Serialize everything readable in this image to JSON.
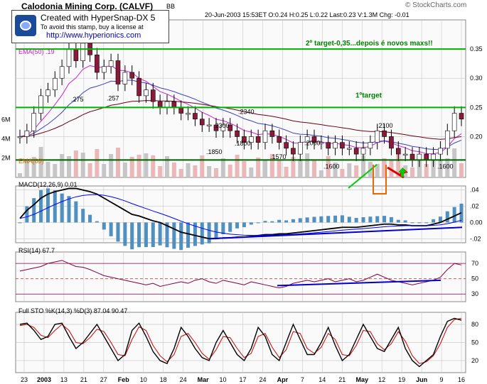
{
  "header": {
    "source": "© StockCharts.com",
    "title": "Calodonia Mining Corp. (CALVF)",
    "exchange": "BB",
    "quote": "20-Jun-2003 15:53ET  O:0.24 H:0.25 L:0.22 Last:0.23 V:1.3M Chg: -0.01"
  },
  "stamp": {
    "line1": "Created with HyperSnap-DX 5",
    "line2": "To avoid this stamp, buy a license at",
    "line3": "http://www.hyperionics.com"
  },
  "colors": {
    "bg": "#fafafa",
    "grid": "#c8c8c8",
    "price_up": "#ffffff",
    "price_down": "#8b1a3a",
    "ema_short": "#d020d0",
    "ema_long": "#6a0018",
    "volume": "#c0c0c0",
    "volume_down": "#e8b0b0",
    "target_line": "#00b000",
    "support_line": "#006000",
    "trend_line": "#0000cc",
    "arrow_red": "#dd0000",
    "arrow_green": "#00cc00",
    "arrow_orange": "#ee6600",
    "macd": "#000000",
    "signal": "#0000ff",
    "histogram": "#5090c0",
    "rsi": "#800040",
    "sto_k": "#000000",
    "sto_d": "#cc0000"
  },
  "chart_data": [
    {
      "type": "line",
      "panel": "price",
      "legend": [
        "EMA(50) .19",
        "EMA(60)"
      ],
      "yaxis_right": [
        0.35,
        0.3,
        0.25,
        0.2
      ],
      "yaxis_left_volume": [
        "6M",
        "4M",
        "2M"
      ],
      "ylim": [
        0.13,
        0.4
      ],
      "x_labels": [
        "23",
        "2003",
        "13",
        "21",
        "27",
        "Feb",
        "10",
        "18",
        "24",
        "Mar",
        "10",
        "17",
        "24",
        "Apr",
        "7",
        "14",
        "21",
        "May",
        "12",
        "19",
        "Jun",
        "9",
        "16"
      ],
      "close": [
        0.2,
        0.21,
        0.24,
        0.27,
        0.28,
        0.3,
        0.32,
        0.35,
        0.33,
        0.36,
        0.34,
        0.31,
        0.32,
        0.33,
        0.29,
        0.31,
        0.3,
        0.27,
        0.28,
        0.26,
        0.25,
        0.26,
        0.25,
        0.24,
        0.24,
        0.23,
        0.22,
        0.22,
        0.21,
        0.22,
        0.21,
        0.2,
        0.19,
        0.2,
        0.19,
        0.21,
        0.2,
        0.19,
        0.18,
        0.17,
        0.19,
        0.2,
        0.19,
        0.19,
        0.18,
        0.19,
        0.18,
        0.18,
        0.17,
        0.18,
        0.19,
        0.21,
        0.2,
        0.18,
        0.17,
        0.17,
        0.16,
        0.17,
        0.16,
        0.17,
        0.18,
        0.21,
        0.24,
        0.23
      ],
      "levels": [
        {
          "label": "2º target-0,35...depois é novos maxs!!",
          "value": 0.35
        },
        {
          "label": "1ºtarget",
          "value": 0.25
        },
        {
          "label": "",
          "value": 0.16
        }
      ],
      "annotations": [
        {
          "text": ".275",
          "value": 0.275
        },
        {
          "text": ".257",
          "value": 0.257
        },
        {
          "text": ".2300",
          "value": 0.23
        },
        {
          "text": ".2340",
          "value": 0.234
        },
        {
          "text": ".1850",
          "value": 0.185
        },
        {
          "text": ".1800",
          "value": 0.18
        },
        {
          "text": ".2000",
          "value": 0.2
        },
        {
          "text": ".1570",
          "value": 0.157
        },
        {
          "text": ".1600",
          "value": 0.16
        },
        {
          "text": ".2100",
          "value": 0.21
        },
        {
          "text": ".1600",
          "value": 0.16
        }
      ]
    },
    {
      "type": "line",
      "panel": "macd",
      "title": "MACD(12,26,9) 0.01",
      "yaxis_right": [
        ".04",
        ".02",
        "0.00",
        "-.02"
      ],
      "ylim": [
        -0.025,
        0.045
      ],
      "macd": [
        0.005,
        0.015,
        0.022,
        0.03,
        0.035,
        0.038,
        0.04,
        0.042,
        0.042,
        0.04,
        0.038,
        0.035,
        0.03,
        0.025,
        0.02,
        0.015,
        0.01,
        0.008,
        0.005,
        0.002,
        0.0,
        -0.004,
        -0.008,
        -0.012,
        -0.014,
        -0.016,
        -0.018,
        -0.02,
        -0.02,
        -0.019,
        -0.019,
        -0.018,
        -0.018,
        -0.017,
        -0.016,
        -0.015,
        -0.015,
        -0.014,
        -0.014,
        -0.013,
        -0.012,
        -0.011,
        -0.01,
        -0.009,
        -0.008,
        -0.007,
        -0.006,
        -0.006,
        -0.006,
        -0.005,
        -0.004,
        -0.003,
        -0.002,
        -0.002,
        -0.003,
        -0.003,
        -0.004,
        -0.004,
        -0.004,
        -0.002,
        0.0,
        0.004,
        0.008,
        0.012
      ]
    },
    {
      "type": "line",
      "panel": "rsi",
      "title": "RSI(14) 67.7",
      "yaxis_right": [
        "70",
        "50",
        "30"
      ],
      "ylim": [
        20,
        85
      ],
      "rsi": [
        60,
        62,
        64,
        66,
        70,
        72,
        74,
        70,
        66,
        65,
        62,
        58,
        54,
        52,
        50,
        48,
        46,
        44,
        42,
        44,
        40,
        42,
        44,
        46,
        44,
        48,
        50,
        46,
        44,
        48,
        46,
        44,
        42,
        46,
        44,
        42,
        40,
        38,
        40,
        44,
        46,
        48,
        46,
        48,
        50,
        46,
        48,
        50,
        46,
        48,
        52,
        56,
        52,
        48,
        46,
        44,
        42,
        44,
        46,
        48,
        52,
        62,
        70,
        68
      ]
    },
    {
      "type": "line",
      "panel": "stochastic",
      "title": "Full STO %K(14,3) %D(3) 87.04 90.47",
      "yaxis_right": [
        "80",
        "50",
        "20"
      ],
      "ylim": [
        0,
        100
      ],
      "k": [
        80,
        82,
        70,
        55,
        60,
        80,
        82,
        60,
        40,
        50,
        65,
        80,
        60,
        40,
        20,
        30,
        70,
        82,
        60,
        35,
        20,
        15,
        40,
        75,
        60,
        40,
        25,
        20,
        50,
        70,
        50,
        30,
        20,
        40,
        75,
        60,
        30,
        20,
        50,
        80,
        55,
        30,
        30,
        50,
        75,
        45,
        20,
        30,
        55,
        80,
        60,
        40,
        35,
        55,
        75,
        40,
        20,
        10,
        20,
        30,
        60,
        85,
        90,
        87
      ],
      "d": [
        78,
        80,
        75,
        62,
        58,
        70,
        80,
        70,
        50,
        48,
        58,
        72,
        68,
        50,
        30,
        28,
        55,
        76,
        70,
        45,
        28,
        18,
        30,
        60,
        65,
        50,
        32,
        22,
        38,
        60,
        58,
        40,
        25,
        32,
        60,
        65,
        42,
        25,
        38,
        68,
        65,
        40,
        32,
        42,
        65,
        55,
        30,
        28,
        45,
        70,
        68,
        48,
        38,
        48,
        68,
        52,
        28,
        15,
        18,
        28,
        48,
        75,
        88,
        90
      ]
    }
  ]
}
